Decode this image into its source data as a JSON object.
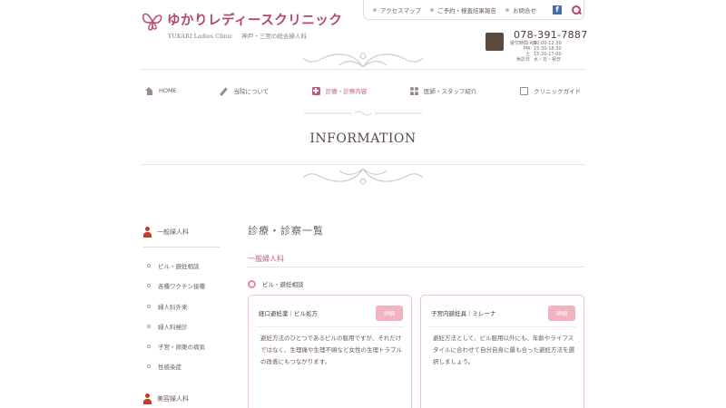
{
  "header": {
    "logo_text": "ゆかりレディースクリニック",
    "logo_sub_en": "YUKARI Ladies Clinic",
    "logo_sub_jp": "神戸・三宮の総合婦人科",
    "top_links": [
      "アクセスマップ",
      "ご予約・検査結果報告",
      "お問合せ"
    ],
    "phone": "078-391-7887",
    "hours": [
      {
        "label": "受付時間 AM",
        "value": "10:00-12:30"
      },
      {
        "label": "PM",
        "value": "15:30-18:30"
      },
      {
        "label": "土",
        "value": "15:20-17:00"
      },
      {
        "label": "休診日",
        "value": "水・日・祝日"
      }
    ]
  },
  "nav": {
    "items": [
      "HOME",
      "当院について",
      "診療・診察内容",
      "医師・スタッフ紹介",
      "クリニックガイド"
    ],
    "active_index": 2
  },
  "page": {
    "title": "INFORMATION"
  },
  "sidebar": {
    "section1_title": "一般婦人科",
    "items": [
      "ピル・避妊相談",
      "各種ワクチン接種",
      "婦人科外来",
      "婦人科検診",
      "子宮・卵巣の病気",
      "性感染症"
    ],
    "section2_title": "美容婦人科"
  },
  "main": {
    "title": "診療・診察一覧",
    "category": "一般婦人科",
    "subcategory": "ピル・避妊相談",
    "cards": [
      {
        "title": "経口避妊薬｜ピル処方",
        "button": "詳細",
        "body": "避妊方法のひとつであるピルの服用ですが、それだけではなく、生理痛や生理不順など女性の生理トラブルの改善にもつながります。"
      },
      {
        "title": "子宮内避妊具｜ミレーナ",
        "button": "詳細",
        "body": "避妊方法として、ピル服用以外にも、年齢やライフスタイルに合わせて自分自身に最も合った避妊方法を選択しましょう。"
      }
    ]
  },
  "colors": {
    "brand": "#b5456a",
    "accent": "#c05a78",
    "button": "#f2b3c0",
    "card_border": "#f0c4cf"
  }
}
